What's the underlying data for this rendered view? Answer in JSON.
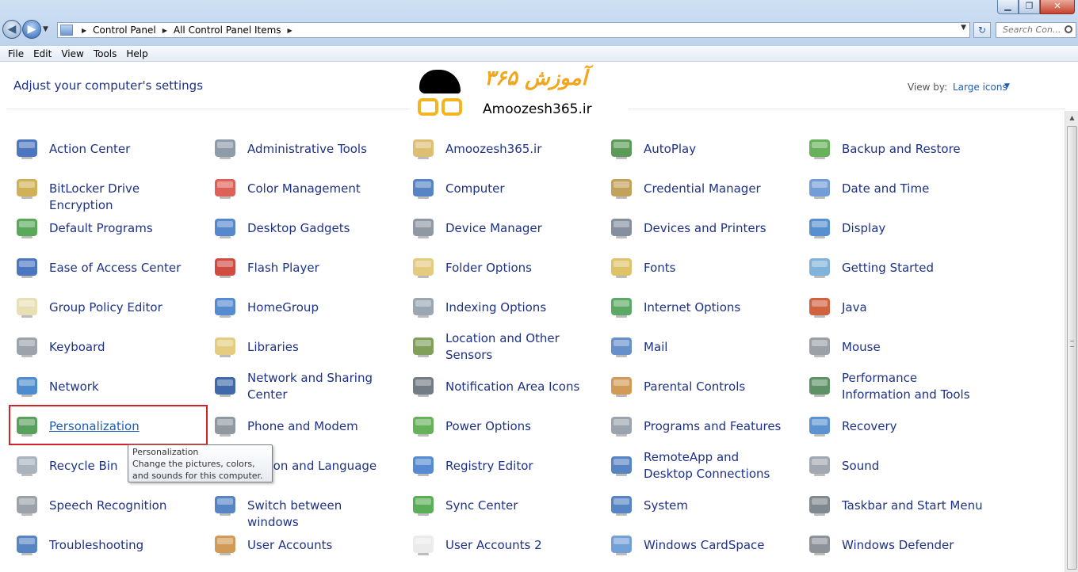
{
  "window": {
    "minimize_glyph": "▁",
    "maximize_glyph": "❐",
    "close_glyph": "✕"
  },
  "nav": {
    "back_glyph": "◀",
    "forward_glyph": "▶",
    "dropdown_glyph": "▼"
  },
  "address": {
    "crumbs": [
      "Control Panel",
      "All Control Panel Items"
    ],
    "separator": "▶",
    "dropdown_glyph": "▼",
    "refresh_glyph": "↻"
  },
  "search": {
    "placeholder": "Search Con..."
  },
  "menu": [
    "File",
    "Edit",
    "View",
    "Tools",
    "Help"
  ],
  "header": {
    "title": "Adjust your computer's settings",
    "view_by_label": "View by:",
    "view_by_value": "Large icons",
    "view_by_arrow": "▼"
  },
  "logo": {
    "persian_text": "آموزش ۳۶۵",
    "site_text": "Amoozesh365.ir"
  },
  "items": [
    {
      "label": "Action Center",
      "icon": "flag-icon",
      "color": "#2d5fb5"
    },
    {
      "label": "Administrative Tools",
      "icon": "admin-tools-icon",
      "color": "#7a8a9c"
    },
    {
      "label": "Amoozesh365.ir",
      "icon": "user-folder-icon",
      "color": "#d8b35a"
    },
    {
      "label": "AutoPlay",
      "icon": "autoplay-icon",
      "color": "#3f8a3a"
    },
    {
      "label": "Backup and Restore",
      "icon": "backup-icon",
      "color": "#4ea33e"
    },
    {
      "label": "BitLocker Drive Encryption",
      "icon": "bitlocker-icon",
      "color": "#c9a33a"
    },
    {
      "label": "Color Management",
      "icon": "color-management-icon",
      "color": "#d8453b"
    },
    {
      "label": "Computer",
      "icon": "computer-icon",
      "color": "#3a6fb8"
    },
    {
      "label": "Credential Manager",
      "icon": "credential-icon",
      "color": "#b8923e"
    },
    {
      "label": "Date and Time",
      "icon": "calendar-icon",
      "color": "#5b8ccf"
    },
    {
      "label": "Default Programs",
      "icon": "default-programs-icon",
      "color": "#3c9a3c"
    },
    {
      "label": "Desktop Gadgets",
      "icon": "gadgets-icon",
      "color": "#3a73c4"
    },
    {
      "label": "Device Manager",
      "icon": "device-manager-icon",
      "color": "#7d8793"
    },
    {
      "label": "Devices and Printers",
      "icon": "printer-icon",
      "color": "#6f7d8c"
    },
    {
      "label": "Display",
      "icon": "display-icon",
      "color": "#3a7bc8"
    },
    {
      "label": "Ease of Access Center",
      "icon": "ease-of-access-icon",
      "color": "#2d5fb5"
    },
    {
      "label": "Flash Player",
      "icon": "flash-icon",
      "color": "#c82c1f"
    },
    {
      "label": "Folder Options",
      "icon": "folder-options-icon",
      "color": "#e0c26a"
    },
    {
      "label": "Fonts",
      "icon": "fonts-icon",
      "color": "#d9b94f"
    },
    {
      "label": "Getting Started",
      "icon": "getting-started-icon",
      "color": "#6aa6d6"
    },
    {
      "label": "Group Policy Editor",
      "icon": "policy-icon",
      "color": "#e5d9a8"
    },
    {
      "label": "HomeGroup",
      "icon": "homegroup-icon",
      "color": "#3a77c9"
    },
    {
      "label": "Indexing Options",
      "icon": "indexing-icon",
      "color": "#8a97a6"
    },
    {
      "label": "Internet Options",
      "icon": "internet-icon",
      "color": "#3f9a4a"
    },
    {
      "label": "Java",
      "icon": "java-icon",
      "color": "#c8471f"
    },
    {
      "label": "Keyboard",
      "icon": "keyboard-icon",
      "color": "#8b939c"
    },
    {
      "label": "Libraries",
      "icon": "libraries-icon",
      "color": "#e2c36b"
    },
    {
      "label": "Location and Other Sensors",
      "icon": "sensors-icon",
      "color": "#6a8f3c"
    },
    {
      "label": "Mail",
      "icon": "mail-icon",
      "color": "#4a7cc0"
    },
    {
      "label": "Mouse",
      "icon": "mouse-icon",
      "color": "#8a8f96"
    },
    {
      "label": "Network",
      "icon": "network-icon",
      "color": "#2e78c6"
    },
    {
      "label": "Network and Sharing Center",
      "icon": "network-sharing-icon",
      "color": "#1e4f9a"
    },
    {
      "label": "Notification Area Icons",
      "icon": "notification-icon",
      "color": "#5a6470"
    },
    {
      "label": "Parental Controls",
      "icon": "parental-controls-icon",
      "color": "#c98a3a"
    },
    {
      "label": "Performance Information and Tools",
      "icon": "performance-icon",
      "color": "#3f7f4a"
    },
    {
      "label": "Personalization",
      "icon": "personalization-icon",
      "color": "#3c8f3f",
      "selected": true
    },
    {
      "label": "Phone and Modem",
      "icon": "phone-icon",
      "color": "#7d868f"
    },
    {
      "label": "Power Options",
      "icon": "power-icon",
      "color": "#4ea33e"
    },
    {
      "label": "Programs and Features",
      "icon": "programs-icon",
      "color": "#8a94a0"
    },
    {
      "label": "Recovery",
      "icon": "recovery-icon",
      "color": "#3f7fc8"
    },
    {
      "label": "Recycle Bin",
      "icon": "recycle-bin-icon",
      "color": "#9aa6b3"
    },
    {
      "label": "Region and Language",
      "icon": "region-icon",
      "color": "#3a7bc8"
    },
    {
      "label": "Registry Editor",
      "icon": "registry-icon",
      "color": "#3a77c9"
    },
    {
      "label": "RemoteApp and Desktop Connections",
      "icon": "remoteapp-icon",
      "color": "#3a6fb8"
    },
    {
      "label": "Sound",
      "icon": "sound-icon",
      "color": "#9099a3"
    },
    {
      "label": "Speech Recognition",
      "icon": "microphone-icon",
      "color": "#8a929b"
    },
    {
      "label": "Switch between windows",
      "icon": "switch-windows-icon",
      "color": "#3a6fb8"
    },
    {
      "label": "Sync Center",
      "icon": "sync-icon",
      "color": "#3ca03a"
    },
    {
      "label": "System",
      "icon": "system-icon",
      "color": "#3a6fb8"
    },
    {
      "label": "Taskbar and Start Menu",
      "icon": "taskbar-icon",
      "color": "#6a737d"
    },
    {
      "label": "Troubleshooting",
      "icon": "troubleshooting-icon",
      "color": "#3a6fb8"
    },
    {
      "label": "User Accounts",
      "icon": "user-accounts-icon",
      "color": "#c98a3a"
    },
    {
      "label": "User Accounts 2",
      "icon": "blank-file-icon",
      "color": "#e8e8e8"
    },
    {
      "label": "Windows CardSpace",
      "icon": "cardspace-icon",
      "color": "#5a8fd0"
    },
    {
      "label": "Windows Defender",
      "icon": "defender-icon",
      "color": "#7a8088"
    }
  ],
  "tooltip": {
    "title": "Personalization",
    "body": "Change the pictures, colors, and sounds for this computer."
  }
}
